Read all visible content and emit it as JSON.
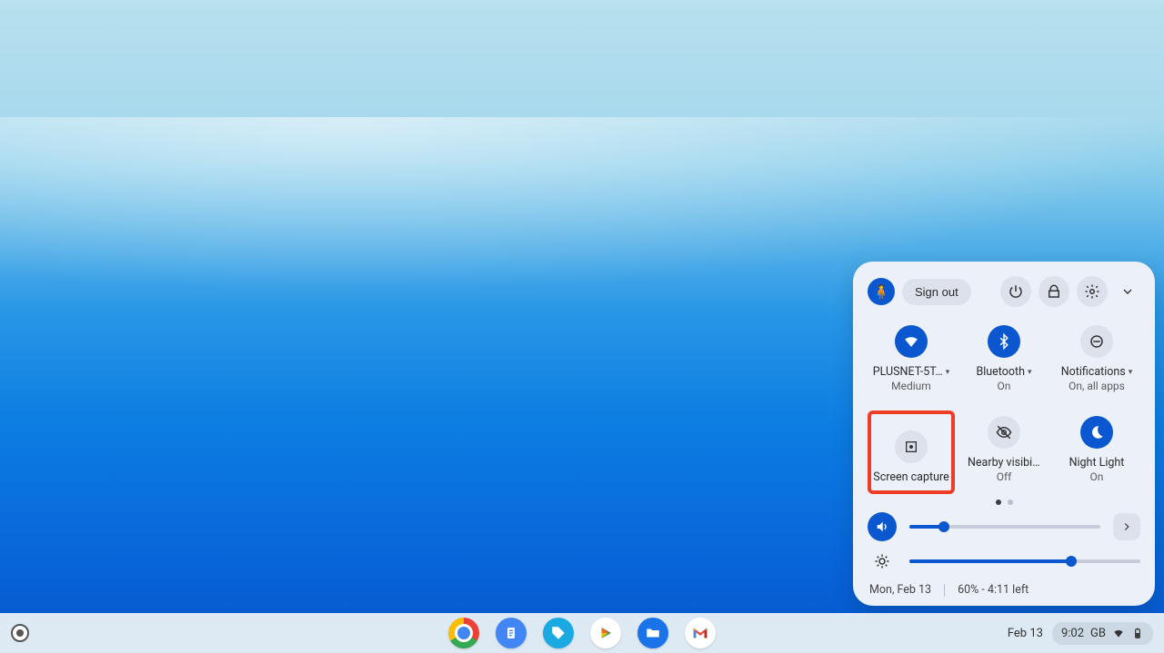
{
  "panel": {
    "signout_label": "Sign out",
    "tiles": [
      {
        "title": "PLUSNET-5T…",
        "sub": "Medium",
        "on": true,
        "has_dropdown": true
      },
      {
        "title": "Bluetooth",
        "sub": "On",
        "on": true,
        "has_dropdown": true
      },
      {
        "title": "Notifications",
        "sub": "On, all apps",
        "on": false,
        "has_dropdown": true
      },
      {
        "title": "Screen capture",
        "sub": "",
        "on": false,
        "has_dropdown": false,
        "highlight": true,
        "two_line_title": true
      },
      {
        "title": "Nearby visibil…",
        "sub": "Off",
        "on": false,
        "has_dropdown": false
      },
      {
        "title": "Night Light",
        "sub": "On",
        "on": true,
        "has_dropdown": false
      }
    ],
    "volume_percent": 18,
    "brightness_percent": 70,
    "footer_date": "Mon, Feb 13",
    "footer_battery": "60% - 4:11 left",
    "pager": {
      "current": 0,
      "total": 2
    }
  },
  "shelf": {
    "date": "Feb 13",
    "status_time": "9:02",
    "status_aux": "GB"
  }
}
